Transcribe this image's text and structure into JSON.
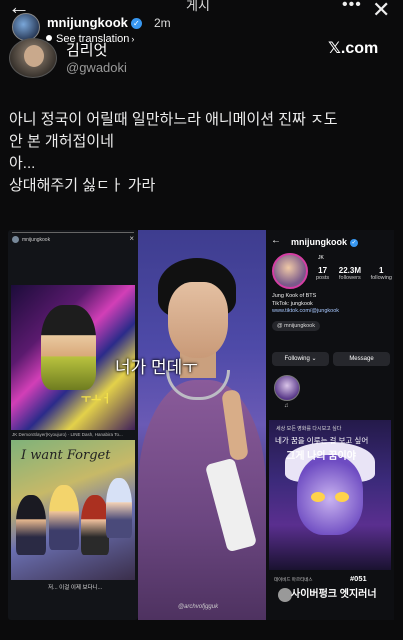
{
  "story": {
    "title": "게시",
    "username": "mnijungkook",
    "time": "2m",
    "see_translation": "See translation",
    "back_icon": "arrow-left-icon",
    "more_icon": "more-dots-icon",
    "close_icon": "close-icon"
  },
  "tweet": {
    "display_name": "김리엇",
    "handle": "@gwadoki",
    "source": "𝕏.com",
    "lines": [
      "아니 정국이 어릴때 일만하느라 애니메이션 진짜 ㅈ도",
      "안 본 개허접이네",
      "아...",
      "상대해주기 싫ㄷㅏ 가라"
    ]
  },
  "collage": {
    "left": {
      "username": "mnijungkook",
      "close": "×",
      "art_text": "ㅜㅗㅓ",
      "meta": "JK  DemonSlayer(Kyoujuro) · LINE Dash, Hanabira To...",
      "script_text": "I want Forget",
      "caption": "저... 이걸 이제 보다니..."
    },
    "center": {
      "subtitle": "너가 먼데ㅜ",
      "watermark": "@archvofjgguk"
    },
    "right": {
      "username": "mnijungkook",
      "name_small": "JK",
      "stats": [
        {
          "num": "17",
          "label": "posts"
        },
        {
          "num": "22.3M",
          "label": "followers"
        },
        {
          "num": "1",
          "label": "following"
        }
      ],
      "bio_lines": [
        "Jung Kook of BTS",
        "TikTok: jungkook"
      ],
      "bio_link": "www.tiktok.com/@jungkook",
      "handle_pill": "@ mnijungkook",
      "following_btn": "Following ⌄",
      "message_btn": "Message",
      "highlight_label": "♫",
      "art_small": "세상 모든 영화를 다시보고 싶다",
      "art_sub": "네가 꿈을 이루는 걸 보고 싶어",
      "art_big": "그게 나의 꿈이야",
      "foot_small": "데이비드 마르티네스",
      "foot_num": "#051",
      "foot_big": "사이버펑크 엣지러너"
    }
  }
}
